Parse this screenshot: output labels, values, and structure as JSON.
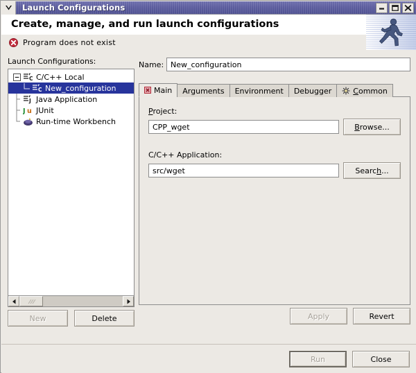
{
  "window": {
    "title": "Launch Configurations",
    "menu_icon": "chevron-down-icon",
    "minimize_label": "minimize-icon",
    "maximize_label": "maximize-icon",
    "close_label": "close-icon"
  },
  "header": {
    "title": "Create, manage, and run launch configurations",
    "status_icon": "error-icon",
    "status_text": "Program does not exist",
    "banner_icon": "running-man-icon"
  },
  "left": {
    "label": "Launch Configurations:",
    "tree": [
      {
        "label": "C/C++ Local",
        "icon": "cpp-launch-icon",
        "depth": 0,
        "expander": "collapse-icon",
        "selected": false
      },
      {
        "label": "New_configuration",
        "icon": "cpp-launch-icon",
        "depth": 1,
        "expander": "none",
        "selected": true
      },
      {
        "label": "Java Application",
        "icon": "java-launch-icon",
        "depth": 0,
        "expander": "none",
        "selected": false
      },
      {
        "label": "JUnit",
        "icon": "junit-icon",
        "depth": 0,
        "expander": "none",
        "selected": false
      },
      {
        "label": "Run-time Workbench",
        "icon": "eclipse-icon",
        "depth": 0,
        "expander": "none",
        "selected": false
      }
    ],
    "scrollbar": {
      "left_arrow_icon": "arrow-left-icon",
      "right_arrow_icon": "arrow-right-icon"
    },
    "buttons": [
      {
        "label": "New",
        "accel": "w",
        "disabled": true,
        "name": "new-button"
      },
      {
        "label": "Delete",
        "accel": "e",
        "disabled": false,
        "name": "delete-button"
      }
    ]
  },
  "right": {
    "name_label": "Name:",
    "name_value": "New_configuration",
    "tabs": [
      {
        "label": "Main",
        "icon": "error-badge-icon",
        "active": true
      },
      {
        "label": "Arguments",
        "icon": "none",
        "active": false
      },
      {
        "label": "Environment",
        "icon": "none",
        "active": false
      },
      {
        "label": "Debugger",
        "icon": "none",
        "active": false
      },
      {
        "label": "Common",
        "icon": "gear-icon",
        "accel": "C",
        "active": false
      }
    ],
    "fields": [
      {
        "label": "Project:",
        "accel": "P",
        "value": "CPP_wget",
        "button": "Browse...",
        "button_accel": "B",
        "input_name": "project-input",
        "button_name": "browse-button"
      },
      {
        "label": "C/C++ Application:",
        "accel": "",
        "value": "src/wget",
        "button": "Search...",
        "button_accel": "h",
        "input_name": "application-input",
        "button_name": "search-button"
      }
    ],
    "buttons": [
      {
        "label": "Apply",
        "accel": "y",
        "disabled": true,
        "name": "apply-button"
      },
      {
        "label": "Revert",
        "accel": "v",
        "disabled": false,
        "name": "revert-button"
      }
    ]
  },
  "footer": {
    "buttons": [
      {
        "label": "Run",
        "accel": "u",
        "disabled": true,
        "name": "run-button",
        "default": true
      },
      {
        "label": "Close",
        "accel": "",
        "disabled": false,
        "name": "close-button",
        "default": false
      }
    ]
  },
  "colors": {
    "titlebar": "#5c5d9e",
    "selection": "#27349c",
    "dialog_bg": "#ece9e4",
    "error": "#c32b3c",
    "banner_blue": "#4a5a86"
  }
}
